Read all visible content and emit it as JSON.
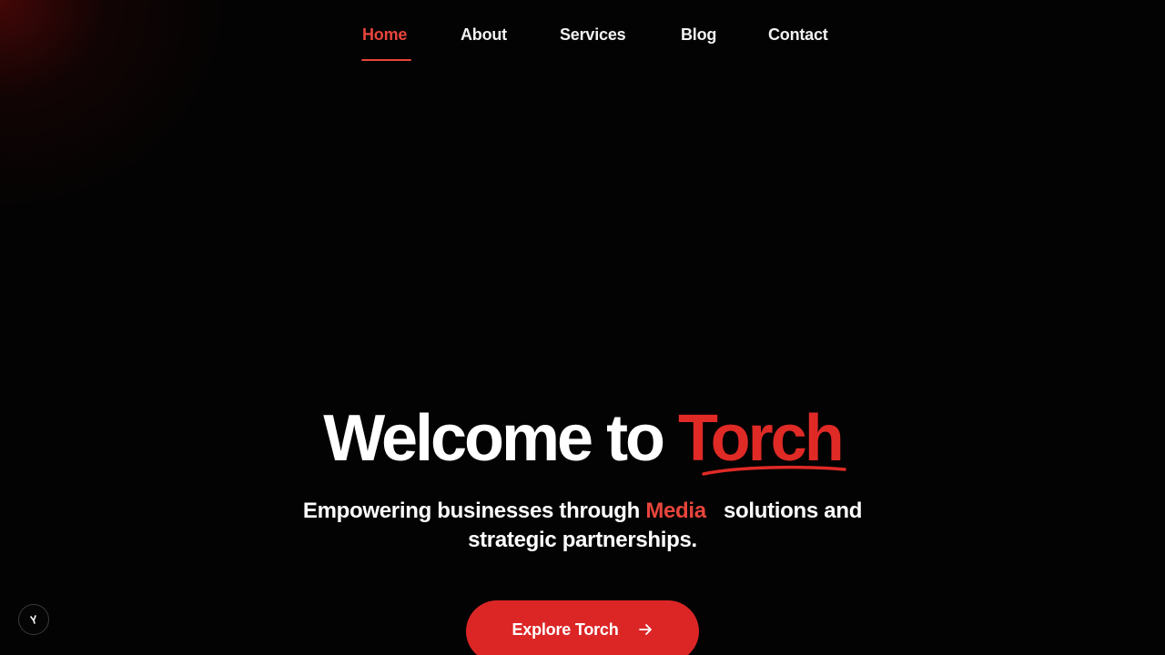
{
  "nav": {
    "items": [
      {
        "label": "Home",
        "active": true
      },
      {
        "label": "About",
        "active": false
      },
      {
        "label": "Services",
        "active": false
      },
      {
        "label": "Blog",
        "active": false
      },
      {
        "label": "Contact",
        "active": false
      }
    ]
  },
  "hero": {
    "title_prefix": "Welcome to ",
    "title_accent": "Torch",
    "subtitle_before": "Empowering businesses through ",
    "subtitle_accent": "Media",
    "subtitle_after": "solutions and strategic partnerships.",
    "cta_label": "Explore Torch",
    "cta_icon": "arrow-right-icon"
  },
  "corner_badge": {
    "icon": "logo-mark-icon"
  },
  "colors": {
    "background": "#030303",
    "accent": "#e02a26",
    "accent_light": "#e8453c",
    "button": "#dc2626",
    "text": "#ffffff"
  }
}
